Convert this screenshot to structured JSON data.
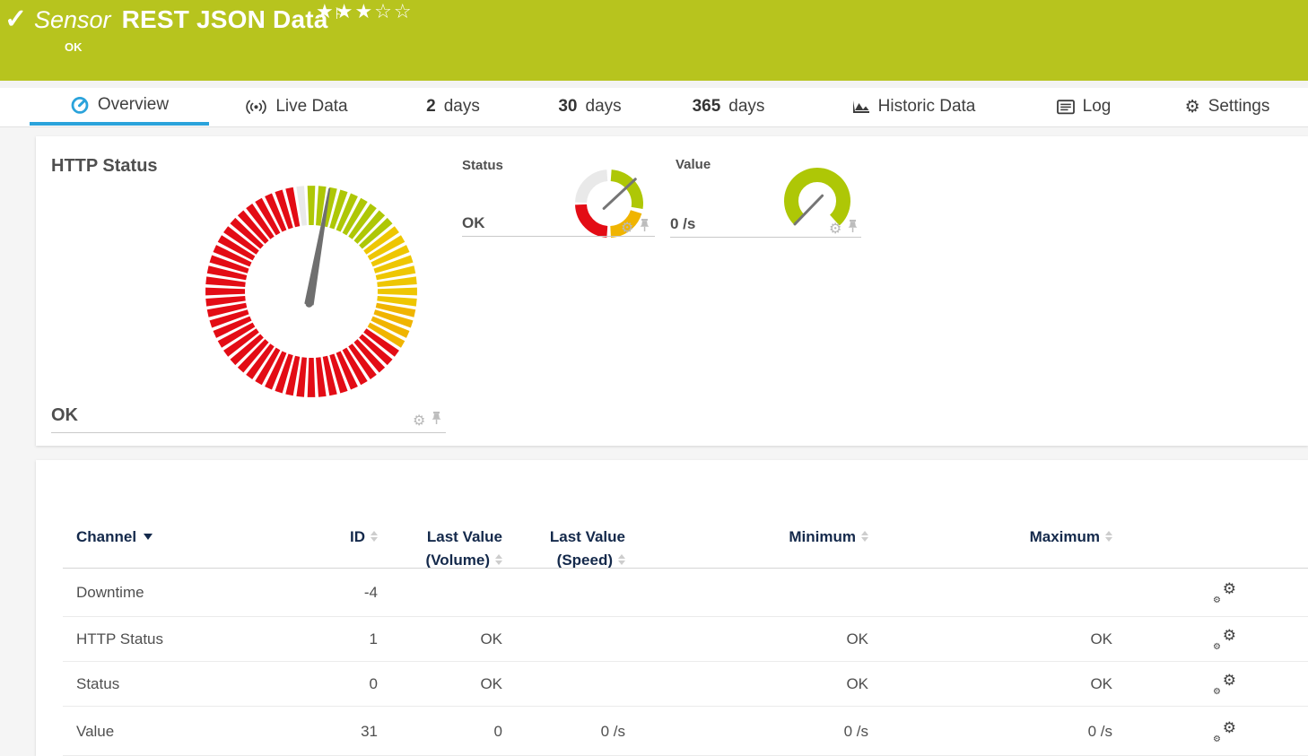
{
  "header": {
    "kind": "Sensor",
    "title": "REST JSON Data",
    "status": "OK",
    "stars_display": "★★★☆☆",
    "rating": {
      "filled": 3,
      "total": 5
    }
  },
  "icons": {
    "check": "✓",
    "flag": "⚐",
    "star_filled": "★",
    "star_empty": "☆",
    "gear": "⚙",
    "pin": "pushpin-shape",
    "sort_desc": "filled-down-triangle",
    "sort_both": "up-down-triangles",
    "overview": "gauge-circle",
    "live": "broadcast-waves",
    "historic": "area-chart",
    "log": "list-box"
  },
  "tabs": [
    {
      "id": "overview",
      "icon": "gauge",
      "label": "Overview",
      "active": true
    },
    {
      "id": "live-data",
      "icon": "live",
      "label": "Live Data",
      "active": false
    },
    {
      "id": "2-days",
      "num": "2",
      "label": "days",
      "active": false
    },
    {
      "id": "30-days",
      "num": "30",
      "label": "days",
      "active": false
    },
    {
      "id": "365-days",
      "num": "365",
      "label": "days",
      "active": false
    },
    {
      "id": "historic-data",
      "icon": "historic",
      "label": "Historic Data",
      "active": false
    },
    {
      "id": "log",
      "icon": "log",
      "label": "Log",
      "active": false
    },
    {
      "id": "settings",
      "icon": "gear",
      "label": "Settings",
      "active": false
    }
  ],
  "gauges": {
    "http_status": {
      "title": "HTTP Status",
      "value": "OK"
    },
    "status": {
      "title": "Status",
      "value": "OK"
    },
    "value": {
      "title": "Value",
      "value": "0 /s"
    }
  },
  "table": {
    "columns": [
      {
        "key": "channel",
        "label": "Channel",
        "sort": "desc"
      },
      {
        "key": "id",
        "label": "ID",
        "sort": "both"
      },
      {
        "key": "last_volume",
        "label_line1": "Last Value",
        "label_line2": "(Volume)",
        "sort": "both"
      },
      {
        "key": "last_speed",
        "label_line1": "Last Value",
        "label_line2": "(Speed)",
        "sort": "both"
      },
      {
        "key": "minimum",
        "label": "Minimum",
        "sort": "both"
      },
      {
        "key": "maximum",
        "label": "Maximum",
        "sort": "both"
      }
    ],
    "rows": [
      {
        "channel": "Downtime",
        "id": "-4",
        "last_volume": "",
        "last_speed": "",
        "minimum": "",
        "maximum": ""
      },
      {
        "channel": "HTTP Status",
        "id": "1",
        "last_volume": "OK",
        "last_speed": "",
        "minimum": "OK",
        "maximum": "OK"
      },
      {
        "channel": "Status",
        "id": "0",
        "last_volume": "OK",
        "last_speed": "",
        "minimum": "OK",
        "maximum": "OK"
      },
      {
        "channel": "Value",
        "id": "31",
        "last_volume": "0",
        "last_speed": "0 /s",
        "minimum": "0 /s",
        "maximum": "0 /s"
      }
    ]
  },
  "colors": {
    "header_bg": "#b7c41e",
    "tab_active": "#2ba3db",
    "gauge_green": "#aec706",
    "gauge_yellow": "#eec602",
    "gauge_orange": "#f0b400",
    "gauge_red": "#e30c15",
    "gauge_gray": "#e9e9e9",
    "needle": "#6f6f6f",
    "table_header_text": "#14294b"
  }
}
